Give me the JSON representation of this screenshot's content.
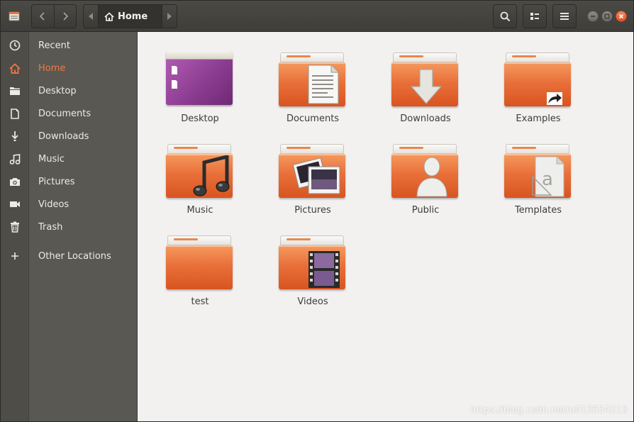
{
  "header": {
    "path_label": "Home"
  },
  "sidebar": {
    "items": [
      {
        "label": "Recent",
        "icon": "clock-icon"
      },
      {
        "label": "Home",
        "icon": "home-icon",
        "active": true
      },
      {
        "label": "Desktop",
        "icon": "folder-icon"
      },
      {
        "label": "Documents",
        "icon": "document-icon"
      },
      {
        "label": "Downloads",
        "icon": "download-icon"
      },
      {
        "label": "Music",
        "icon": "music-icon"
      },
      {
        "label": "Pictures",
        "icon": "camera-icon"
      },
      {
        "label": "Videos",
        "icon": "video-icon"
      },
      {
        "label": "Trash",
        "icon": "trash-icon"
      },
      {
        "label": "Other Locations",
        "icon": "plus-icon"
      }
    ]
  },
  "main": {
    "folders": [
      {
        "label": "Desktop",
        "icon": "desktop-folder-icon"
      },
      {
        "label": "Documents",
        "icon": "documents-folder-icon"
      },
      {
        "label": "Downloads",
        "icon": "downloads-folder-icon"
      },
      {
        "label": "Examples",
        "icon": "examples-folder-icon"
      },
      {
        "label": "Music",
        "icon": "music-folder-icon"
      },
      {
        "label": "Pictures",
        "icon": "pictures-folder-icon"
      },
      {
        "label": "Public",
        "icon": "public-folder-icon"
      },
      {
        "label": "Templates",
        "icon": "templates-folder-icon"
      },
      {
        "label": "test",
        "icon": "folder-icon"
      },
      {
        "label": "Videos",
        "icon": "videos-folder-icon"
      }
    ]
  },
  "watermark": "https://blog.csdn.net/u013554213",
  "colors": {
    "accent": "#f07746",
    "sidebar_bg": "#5a5852",
    "header_bg": "#3f3e3a",
    "content_bg": "#f2f1f0",
    "close_button": "#e0532a"
  }
}
